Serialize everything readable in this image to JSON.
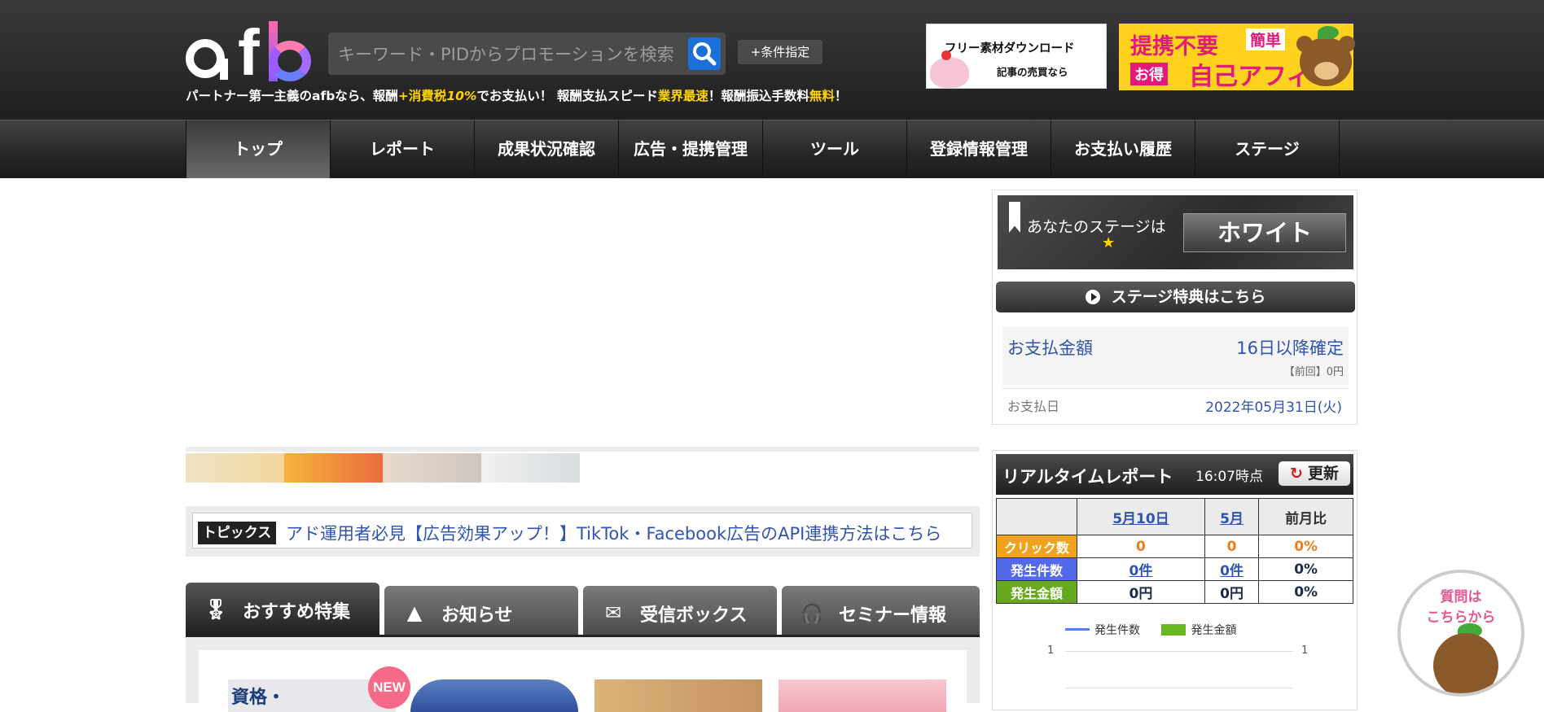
{
  "header": {
    "search_placeholder": "キーワード・PIDからプロモーションを検索",
    "condition_label": "+条件指定",
    "tagline": {
      "p1": "パートナー第一主義のafbなら、報酬",
      "p2": "+消費税",
      "p3": "10%",
      "p4": "でお支払い！ 報酬支払スピード",
      "p5": "業界最速",
      "p6": "！報酬振込手数料",
      "p7": "無料",
      "p8": "！"
    },
    "banner_free": {
      "line1": "フリー素材ダウンロード",
      "line2": "記事の売買なら"
    },
    "banner_affi": {
      "w1": "提携不要",
      "w2": "簡単",
      "w3": "お得",
      "w4": "自己アフィ"
    }
  },
  "nav": [
    {
      "label": "トップ",
      "active": true
    },
    {
      "label": "レポート"
    },
    {
      "label": "成果状況確認"
    },
    {
      "label": "広告・提携管理"
    },
    {
      "label": "ツール"
    },
    {
      "label": "登録情報管理"
    },
    {
      "label": "お支払い履歴"
    },
    {
      "label": "ステージ"
    }
  ],
  "topics": {
    "label": "トピックス",
    "text": "アド運用者必見【広告効果アップ！】TikTok・Facebook広告のAPI連携方法はこちら"
  },
  "tabs": [
    {
      "label": "おすすめ特集",
      "icon": "ribbon-icon"
    },
    {
      "label": "お知らせ",
      "icon": "cone-icon"
    },
    {
      "label": "受信ボックス",
      "icon": "mail-icon"
    },
    {
      "label": "セミナー情報",
      "icon": "headset-icon"
    }
  ],
  "content": {
    "new_badge": "NEW",
    "card1_text": "資格・"
  },
  "stage": {
    "prefix": "あなたのステージは",
    "name": "ホワイト",
    "benefit_button": "ステージ特典はこちら"
  },
  "payment": {
    "amount_label": "お支払金額",
    "amount_value": "16日以降確定",
    "previous": "【前回】0円",
    "date_label": "お支払日",
    "date_value": "2022年05月31日(火)"
  },
  "realtime": {
    "title": "リアルタイムレポート",
    "time": "16:07時点",
    "refresh_label": "更新",
    "columns": [
      "5月10日",
      "5月",
      "前月比"
    ],
    "rows": [
      {
        "label": "クリック数",
        "values": [
          "0",
          "0",
          "0%"
        ]
      },
      {
        "label": "発生件数",
        "values": [
          "0件",
          "0件",
          "0%"
        ]
      },
      {
        "label": "発生金額",
        "values": [
          "0円",
          "0円",
          "0%"
        ]
      }
    ],
    "legend": [
      "発生件数",
      "発生金額"
    ],
    "tick_left": "1",
    "tick_right": "1"
  },
  "help": {
    "text1": "質問は",
    "text2": "こちらから"
  },
  "colors": {
    "link_blue": "#2f55b0",
    "search_blue": "#1a6fd8",
    "highlight_yellow": "#ffd400",
    "click_orange": "#f2a31d",
    "count_blue": "#5468ea",
    "amount_green": "#68a821"
  }
}
